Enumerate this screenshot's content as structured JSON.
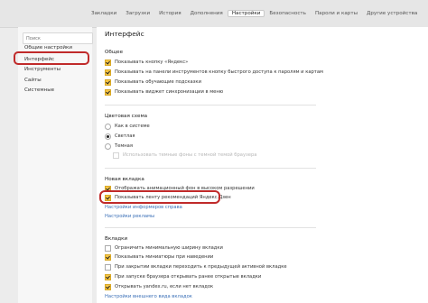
{
  "tabs": [
    {
      "label": "Закладки"
    },
    {
      "label": "Загрузки"
    },
    {
      "label": "История"
    },
    {
      "label": "Дополнения"
    },
    {
      "label": "Настройки",
      "active": true
    },
    {
      "label": "Безопасность"
    },
    {
      "label": "Пароли и карты"
    },
    {
      "label": "Другие устройства"
    }
  ],
  "sidebar": {
    "search_placeholder": "Поиск",
    "items": [
      {
        "label": "Общие настройки"
      },
      {
        "label": "Интерфейс",
        "active": true
      },
      {
        "label": "Инструменты"
      },
      {
        "label": "Сайты"
      },
      {
        "label": "Системные"
      }
    ]
  },
  "main": {
    "title": "Интерфейс",
    "general": {
      "title": "Общее",
      "options": [
        {
          "label": "Показывать кнопку «Яндекс»",
          "checked": true
        },
        {
          "label": "Показывать на панели инструментов кнопку быстрого доступа к паролям и картам",
          "checked": true
        },
        {
          "label": "Показывать обучающие подсказки",
          "checked": true
        },
        {
          "label": "Показывать виджет синхронизации в меню",
          "checked": true
        }
      ]
    },
    "color_scheme": {
      "title": "Цветовая схема",
      "options": [
        {
          "label": "Как в системе",
          "selected": false
        },
        {
          "label": "Светлая",
          "selected": true
        },
        {
          "label": "Темная",
          "selected": false
        },
        {
          "label": "Использовать темные фоны с темной темой браузера",
          "disabled": true
        }
      ]
    },
    "new_tab": {
      "title": "Новая вкладка",
      "options": [
        {
          "label": "Отображать анимационный фон в высоком разрешении",
          "checked": true
        },
        {
          "label": "Показывать ленту рекомендаций Яндекс.Дзен",
          "checked": true
        }
      ],
      "links": [
        {
          "label": "Настройки информеров справа"
        },
        {
          "label": "Настройки рекламы"
        }
      ]
    },
    "tabs_section": {
      "title": "Вкладки",
      "options": [
        {
          "label": "Ограничить минимальную ширину вкладки",
          "checked": false
        },
        {
          "label": "Показывать миниатюры при наведении",
          "checked": true
        },
        {
          "label": "При закрытии вкладки переходить к предыдущей активной вкладке",
          "checked": false
        },
        {
          "label": "При запуске браузера открывать ранее открытые вкладки",
          "checked": true
        },
        {
          "label": "Открывать yandex.ru, если нет вкладок",
          "checked": true
        }
      ],
      "links": [
        {
          "label": "Настройки внешнего вида вкладок"
        }
      ]
    }
  },
  "colors": {
    "checkbox_on": "#f6c544",
    "highlight": "#c02a2a",
    "link": "#3a6fb7"
  }
}
